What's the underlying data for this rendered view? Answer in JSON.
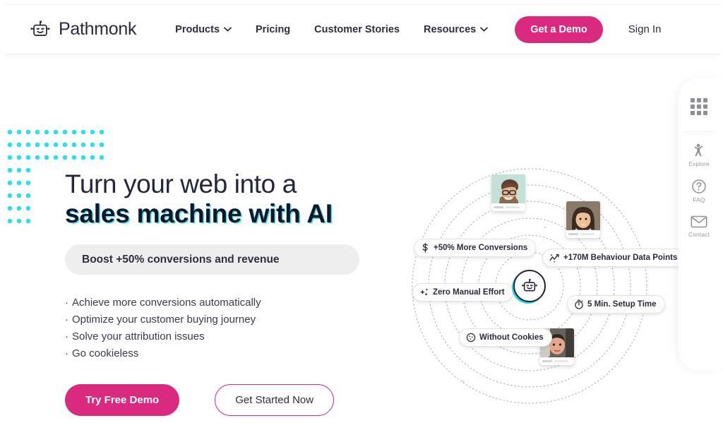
{
  "brand": {
    "name": "Pathmonk",
    "logo_icon": "robot-icon"
  },
  "nav": {
    "links": [
      {
        "label": "Products",
        "has_chevron": true,
        "icon": "chevron-down-icon"
      },
      {
        "label": "Pricing",
        "has_chevron": false,
        "icon": ""
      },
      {
        "label": "Customer Stories",
        "has_chevron": false,
        "icon": ""
      },
      {
        "label": "Resources",
        "has_chevron": true,
        "icon": "chevron-down-icon"
      }
    ],
    "cta_label": "Get a Demo",
    "signin_label": "Sign In"
  },
  "hero": {
    "headline_line1": "Turn your web into a",
    "headline_line2": "sales machine with AI",
    "boost_pill": "Boost +50% conversions and revenue",
    "bullets": [
      "Achieve more conversions automatically",
      "Optimize your customer buying journey",
      "Solve your attribution issues",
      "Go cookieless"
    ],
    "primary_button": "Try Free Demo",
    "secondary_button": "Get Started Now"
  },
  "illustration": {
    "center_icon": "robot-icon",
    "chips": [
      {
        "label": "+50% More Conversions",
        "icon": "dollar-icon"
      },
      {
        "label": "+170M Behaviour Data Points",
        "icon": "trend-line-icon"
      },
      {
        "label": "Zero Manual Effort",
        "icon": "sparkle-icon"
      },
      {
        "label": "5 Min. Setup Time",
        "icon": "stopwatch-icon"
      },
      {
        "label": "Without Cookies",
        "icon": "cookie-icon"
      }
    ],
    "avatars": [
      {
        "name": "avatar-man-glasses"
      },
      {
        "name": "avatar-woman"
      },
      {
        "name": "avatar-man"
      }
    ]
  },
  "side_widget": {
    "grid_icon": "grid-icon",
    "items": [
      {
        "label": "Explore",
        "icon": "explore-person-icon"
      },
      {
        "label": "FAQ",
        "icon": "question-circle-icon"
      },
      {
        "label": "Contact",
        "icon": "envelope-icon"
      }
    ]
  },
  "colors": {
    "accent_pink": "#d92a7f",
    "accent_cyan": "#25d7de",
    "text_dark": "#26263a",
    "pill_gray": "#eeeeee"
  }
}
